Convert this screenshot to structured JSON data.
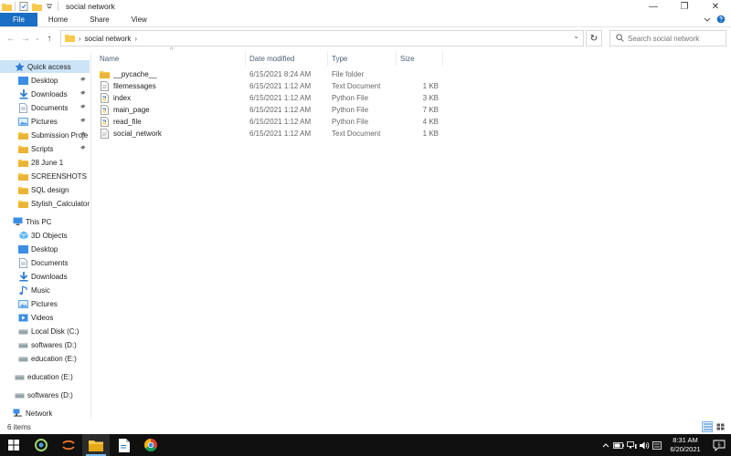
{
  "window": {
    "title": "social network",
    "controls": {
      "minimize": "—",
      "maximize": "❐",
      "close": "✕"
    }
  },
  "ribbon": {
    "tabs": [
      {
        "label": "File"
      },
      {
        "label": "Home"
      },
      {
        "label": "Share"
      },
      {
        "label": "View"
      }
    ]
  },
  "address": {
    "crumbs": [
      "social network"
    ],
    "search_placeholder": "Search social network"
  },
  "nav": {
    "quick_access": "Quick access",
    "quick_items": [
      {
        "label": "Desktop",
        "icon": "desktop-icon",
        "pinned": true
      },
      {
        "label": "Downloads",
        "icon": "downloads-icon",
        "pinned": true
      },
      {
        "label": "Documents",
        "icon": "documents-icon",
        "pinned": true
      },
      {
        "label": "Pictures",
        "icon": "pictures-icon",
        "pinned": true
      },
      {
        "label": "Submission Proje",
        "icon": "folder-icon",
        "pinned": true
      },
      {
        "label": "Scripts",
        "icon": "folder-icon",
        "pinned": true
      },
      {
        "label": "28 June 1",
        "icon": "folder-icon",
        "pinned": false
      },
      {
        "label": "SCREENSHOTS",
        "icon": "folder-icon",
        "pinned": false
      },
      {
        "label": "SQL design",
        "icon": "folder-icon",
        "pinned": false
      },
      {
        "label": "Stylish_Calculator",
        "icon": "folder-icon",
        "pinned": false
      }
    ],
    "this_pc": "This PC",
    "pc_items": [
      {
        "label": "3D Objects",
        "icon": "3d-objects-icon"
      },
      {
        "label": "Desktop",
        "icon": "desktop-icon"
      },
      {
        "label": "Documents",
        "icon": "documents-icon"
      },
      {
        "label": "Downloads",
        "icon": "downloads-icon"
      },
      {
        "label": "Music",
        "icon": "music-icon"
      },
      {
        "label": "Pictures",
        "icon": "pictures-icon"
      },
      {
        "label": "Videos",
        "icon": "videos-icon"
      },
      {
        "label": "Local Disk (C:)",
        "icon": "drive-icon"
      },
      {
        "label": "softwares (D:)",
        "icon": "drive-icon"
      },
      {
        "label": "education (E:)",
        "icon": "drive-icon"
      }
    ],
    "drives": [
      {
        "label": "education (E:)",
        "icon": "drive-icon"
      },
      {
        "label": "softwares (D:)",
        "icon": "drive-icon"
      }
    ],
    "network": "Network"
  },
  "files": {
    "columns": [
      "Name",
      "Date modified",
      "Type",
      "Size"
    ],
    "rows": [
      {
        "name": "__pycache__",
        "date": "6/15/2021 8:24 AM",
        "type": "File folder",
        "size": "",
        "icon": "folder-icon"
      },
      {
        "name": "filemessages",
        "date": "6/15/2021 1:12 AM",
        "type": "Text Document",
        "size": "1 KB",
        "icon": "text-file-icon"
      },
      {
        "name": "index",
        "date": "6/15/2021 1:12 AM",
        "type": "Python File",
        "size": "3 KB",
        "icon": "python-file-icon"
      },
      {
        "name": "main_page",
        "date": "6/15/2021 1:12 AM",
        "type": "Python File",
        "size": "7 KB",
        "icon": "python-file-icon"
      },
      {
        "name": "read_file",
        "date": "6/15/2021 1:12 AM",
        "type": "Python File",
        "size": "4 KB",
        "icon": "python-file-icon"
      },
      {
        "name": "social_network",
        "date": "6/15/2021 1:12 AM",
        "type": "Text Document",
        "size": "1 KB",
        "icon": "text-file-icon"
      }
    ]
  },
  "status": {
    "items_count": "6 items"
  },
  "taskbar": {
    "time": "8:31 AM",
    "date": "6/20/2021",
    "notification_count": "5"
  },
  "colors": {
    "accent": "#1a6ec3",
    "selection": "#cce4f7",
    "folder": "#f8c94c",
    "taskbar": "#101010"
  }
}
